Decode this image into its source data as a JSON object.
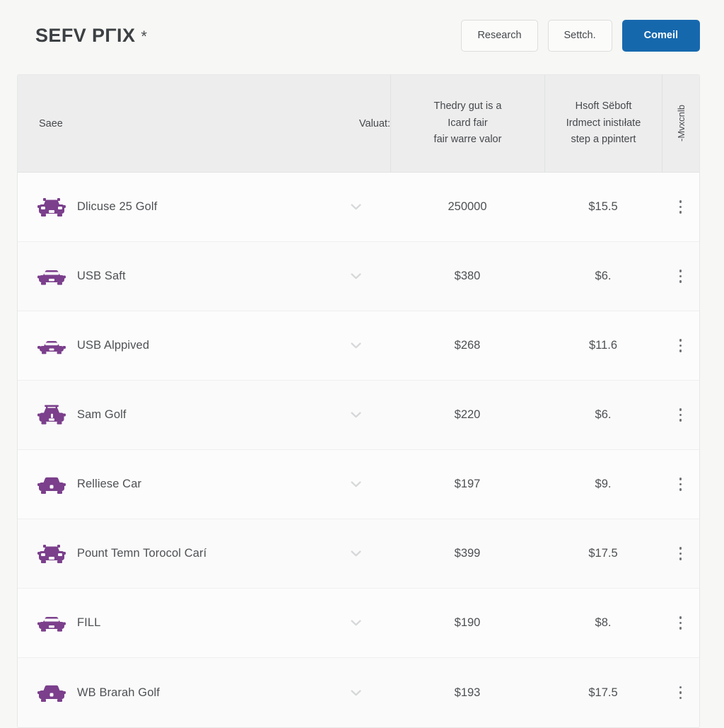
{
  "header": {
    "title": "SEFV PΓIX",
    "title_suffix": "*",
    "buttons": [
      {
        "label": "Research",
        "name": "research-button",
        "primary": false
      },
      {
        "label": "Settch.",
        "name": "settings-button",
        "primary": false
      },
      {
        "label": "Comeil",
        "name": "commit-button",
        "primary": true
      }
    ]
  },
  "table": {
    "columns": {
      "name": "Saee",
      "value": "Valuat:",
      "fair_lines": [
        "Thedry gut is a",
        "Icard fair",
        "fair warre valor"
      ],
      "soft_lines": [
        "Hsoft Sëboft",
        "Irdmect inistıłate",
        "step a ppintert"
      ],
      "vertical": "-Mvxcnlb"
    },
    "rows": [
      {
        "icon": "car-suv-icon",
        "name": "Dlicuse 25 Golf",
        "value": "250000",
        "soft": "$15.5"
      },
      {
        "icon": "car-sedan-icon",
        "name": "USB Saft",
        "value": "$380",
        "soft": "$6."
      },
      {
        "icon": "car-coupe-icon",
        "name": "USB Alppived",
        "value": "$268",
        "soft": "$11.6"
      },
      {
        "icon": "car-wagon-icon",
        "name": "Sam Golf",
        "value": "$220",
        "soft": "$6."
      },
      {
        "icon": "car-van-icon",
        "name": "Relliese Car",
        "value": "$197",
        "soft": "$9."
      },
      {
        "icon": "car-suv-icon",
        "name": "Pount Temn Torocol Carí",
        "value": "$399",
        "soft": "$17.5"
      },
      {
        "icon": "car-sedan-icon",
        "name": "FILL",
        "value": "$190",
        "soft": "$8."
      },
      {
        "icon": "car-van-icon",
        "name": "WB Brarah Golf",
        "value": "$193",
        "soft": "$17.5"
      }
    ]
  },
  "colors": {
    "primary_button": "#1668ad",
    "icon_purple": "#7b3f8c",
    "header_bg": "#ededee",
    "page_bg": "#f7f7f5"
  }
}
